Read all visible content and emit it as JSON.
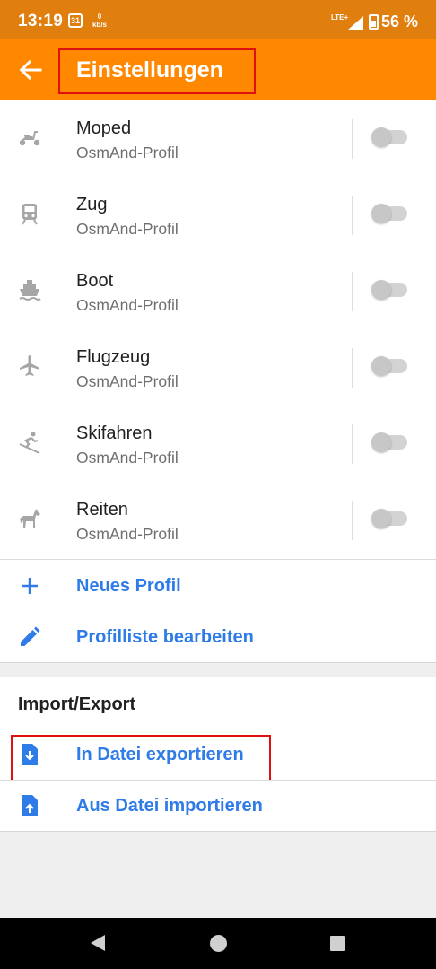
{
  "status_bar": {
    "time": "13:19",
    "calendar_day": "31",
    "data_rate_value": "0",
    "data_rate_unit": "kb/s",
    "network": "LTE+",
    "battery": "56 %"
  },
  "app_bar": {
    "title": "Einstellungen",
    "back_icon": "arrow-back-icon"
  },
  "profiles": [
    {
      "title": "Moped",
      "subtitle": "OsmAnd-Profil",
      "icon": "moped-icon",
      "enabled": false
    },
    {
      "title": "Zug",
      "subtitle": "OsmAnd-Profil",
      "icon": "train-icon",
      "enabled": false
    },
    {
      "title": "Boot",
      "subtitle": "OsmAnd-Profil",
      "icon": "boat-icon",
      "enabled": false
    },
    {
      "title": "Flugzeug",
      "subtitle": "OsmAnd-Profil",
      "icon": "airplane-icon",
      "enabled": false
    },
    {
      "title": "Skifahren",
      "subtitle": "OsmAnd-Profil",
      "icon": "skiing-icon",
      "enabled": false
    },
    {
      "title": "Reiten",
      "subtitle": "OsmAnd-Profil",
      "icon": "horse-icon",
      "enabled": false
    }
  ],
  "actions": {
    "new_profile": "Neues Profil",
    "edit_profiles": "Profilliste bearbeiten"
  },
  "import_export": {
    "title": "Import/Export",
    "export": "In Datei exportieren",
    "import": "Aus Datei importieren"
  },
  "colors": {
    "status_bar": "#e07e0e",
    "app_bar": "#ff8800",
    "accent_blue": "#2f7be8",
    "highlight": "#e01010"
  }
}
